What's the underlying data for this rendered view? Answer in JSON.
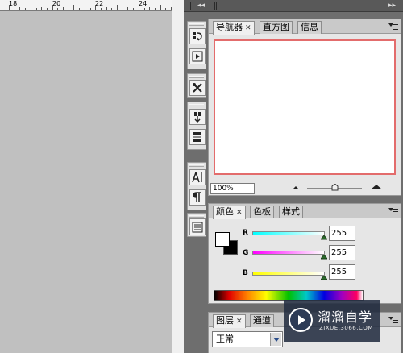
{
  "ruler": {
    "labels": [
      "18",
      "20",
      "22",
      "24"
    ]
  },
  "dock": {
    "collapse_icon": "double-left-arrow"
  },
  "tools": [
    {
      "name": "history-icon"
    },
    {
      "name": "actions-play-icon"
    },
    {
      "name": "tools-preset-icon"
    },
    {
      "name": "clone-source-icon"
    },
    {
      "name": "brushes-icon"
    },
    {
      "name": "character-icon"
    },
    {
      "name": "paragraph-icon"
    },
    {
      "name": "layer-comps-icon"
    }
  ],
  "navigator_panel": {
    "tabs": [
      {
        "label": "导航器",
        "active": true,
        "closable": true
      },
      {
        "label": "直方图",
        "active": false
      },
      {
        "label": "信息",
        "active": false
      }
    ],
    "zoom": "100%",
    "zoom_level": 0.5,
    "preview_border_color": "#e36c6c"
  },
  "color_panel": {
    "tabs": [
      {
        "label": "颜色",
        "active": true,
        "closable": true
      },
      {
        "label": "色板",
        "active": false
      },
      {
        "label": "样式",
        "active": false
      }
    ],
    "foreground": "#ffffff",
    "background": "#000000",
    "channels": [
      {
        "label": "R",
        "value": "255",
        "colors": [
          "#00ffff",
          "#ffffff"
        ]
      },
      {
        "label": "G",
        "value": "255",
        "colors": [
          "#ff00ff",
          "#ffffff"
        ]
      },
      {
        "label": "B",
        "value": "255",
        "colors": [
          "#ffff00",
          "#ffffff"
        ]
      }
    ]
  },
  "layers_panel": {
    "tabs": [
      {
        "label": "图层",
        "active": true,
        "closable": true
      },
      {
        "label": "通道",
        "active": false
      }
    ],
    "blend_mode": "正常"
  },
  "watermark": {
    "title": "溜溜自学",
    "url": "ZIXUE.3066.COM"
  }
}
